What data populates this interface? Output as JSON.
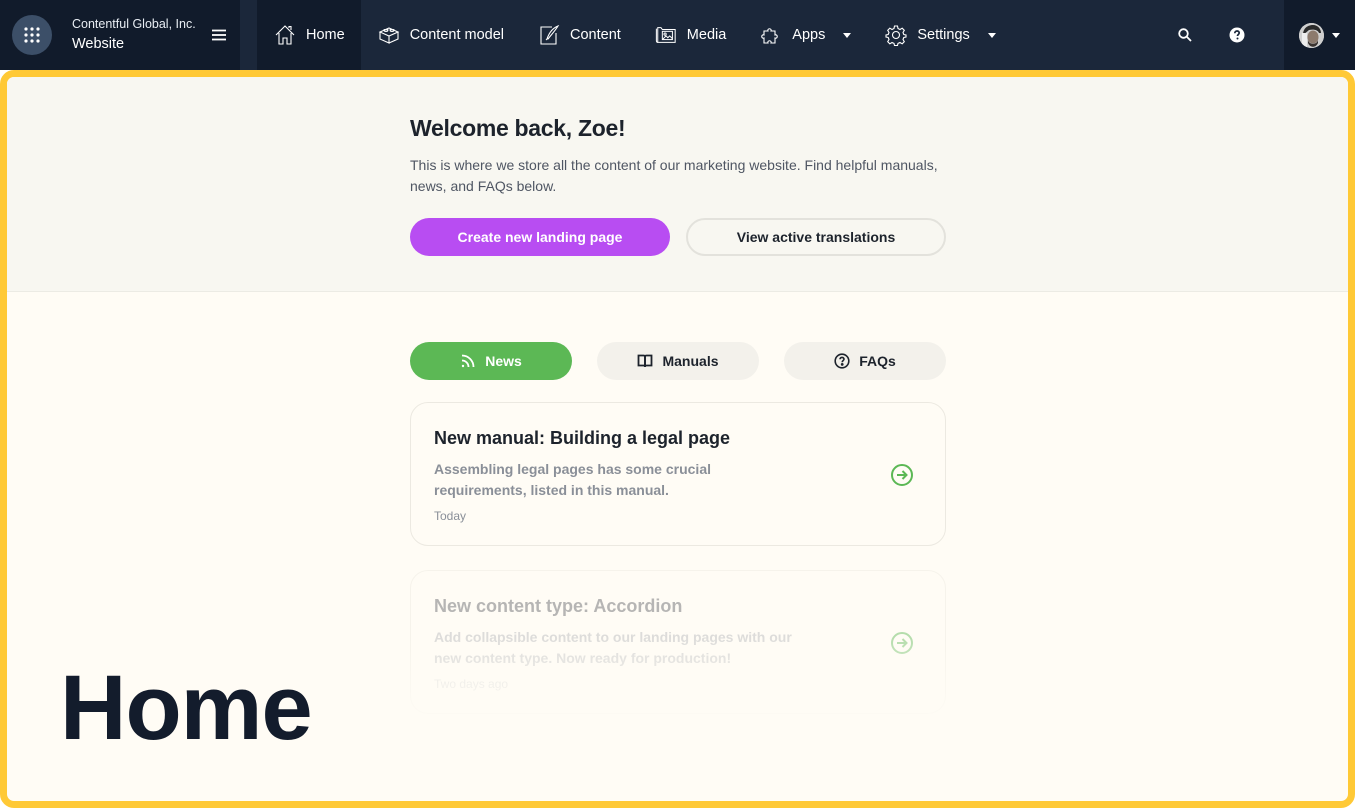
{
  "header": {
    "organization": "Contentful Global, Inc.",
    "space": "Website",
    "nav": [
      {
        "label": "Home",
        "icon": "home-icon",
        "active": true
      },
      {
        "label": "Content model",
        "icon": "content-model-icon",
        "active": false
      },
      {
        "label": "Content",
        "icon": "content-icon",
        "active": false
      },
      {
        "label": "Media",
        "icon": "media-icon",
        "active": false
      },
      {
        "label": "Apps",
        "icon": "puzzle-icon",
        "active": false,
        "dropdown": true
      },
      {
        "label": "Settings",
        "icon": "gear-icon",
        "active": false,
        "dropdown": true
      }
    ],
    "right_icons": [
      "search-icon",
      "help-icon"
    ],
    "account_icon": "avatar"
  },
  "hero": {
    "title": "Welcome back, Zoe!",
    "description": "This is where we store all the content of our marketing website. Find helpful manuals, news, and FAQs below.",
    "primary_button": "Create new landing page",
    "secondary_button": "View active translations"
  },
  "tabs": [
    {
      "label": "News",
      "icon": "rss-icon",
      "active": true
    },
    {
      "label": "Manuals",
      "icon": "book-icon",
      "active": false
    },
    {
      "label": "FAQs",
      "icon": "question-circle-icon",
      "active": false
    }
  ],
  "cards": [
    {
      "title": "New manual: Building a legal page",
      "description": "Assembling legal pages has some crucial requirements, listed in this manual.",
      "date": "Today"
    },
    {
      "title": "New content type: Accordion",
      "description": "Add collapsible content to our landing pages with our new content type. Now ready for production!",
      "date": "Two days ago"
    }
  ],
  "page_label": "Home",
  "colors": {
    "nav_bg": "#1b273a",
    "nav_active_bg": "#111b2b",
    "frame_border": "#ffc936",
    "primary": "#b84df2",
    "tab_active": "#5cb855",
    "text_dark": "#1d232c"
  }
}
